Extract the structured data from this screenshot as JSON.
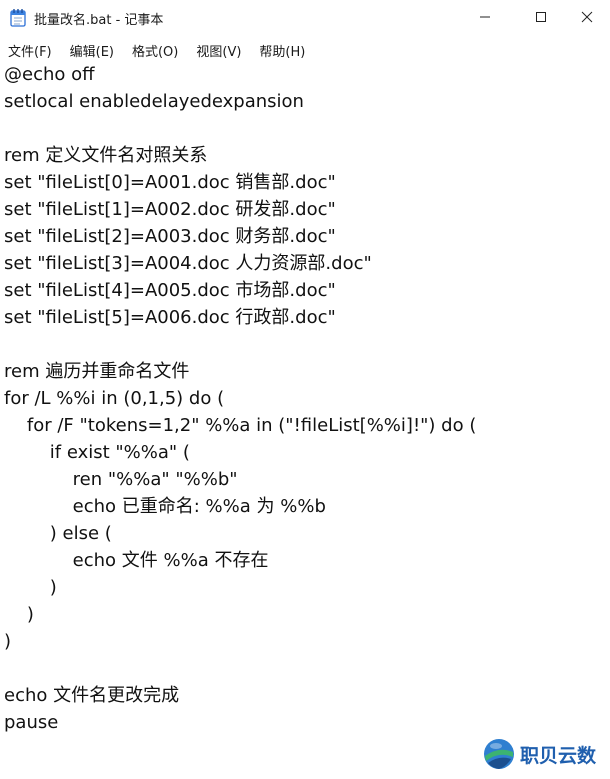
{
  "window": {
    "title": "批量改名.bat - 记事本",
    "app_icon": "notepad-icon",
    "controls": [
      "minimize-icon",
      "maximize-icon",
      "close-icon"
    ]
  },
  "menu": [
    "文件(F)",
    "编辑(E)",
    "格式(O)",
    "视图(V)",
    "帮助(H)"
  ],
  "editor": {
    "lines": [
      "@echo off",
      "setlocal enabledelayedexpansion",
      "",
      "rem 定义文件名对照关系",
      "set \"fileList[0]=A001.doc 销售部.doc\"",
      "set \"fileList[1]=A002.doc 研发部.doc\"",
      "set \"fileList[2]=A003.doc 财务部.doc\"",
      "set \"fileList[3]=A004.doc 人力资源部.doc\"",
      "set \"fileList[4]=A005.doc 市场部.doc\"",
      "set \"fileList[5]=A006.doc 行政部.doc\"",
      "",
      "rem 遍历并重命名文件",
      "for /L %%i in (0,1,5) do (",
      "    for /F \"tokens=1,2\" %%a in (\"!fileList[%%i]!\") do (",
      "        if exist \"%%a\" (",
      "            ren \"%%a\" \"%%b\"",
      "            echo 已重命名: %%a 为 %%b",
      "        ) else (",
      "            echo 文件 %%a 不存在",
      "        )",
      "    )",
      ")",
      "",
      "echo 文件名更改完成",
      "pause"
    ]
  },
  "watermark": {
    "text": "职贝云数",
    "logo": "globe-logo-icon",
    "color": "#1f5fae"
  }
}
